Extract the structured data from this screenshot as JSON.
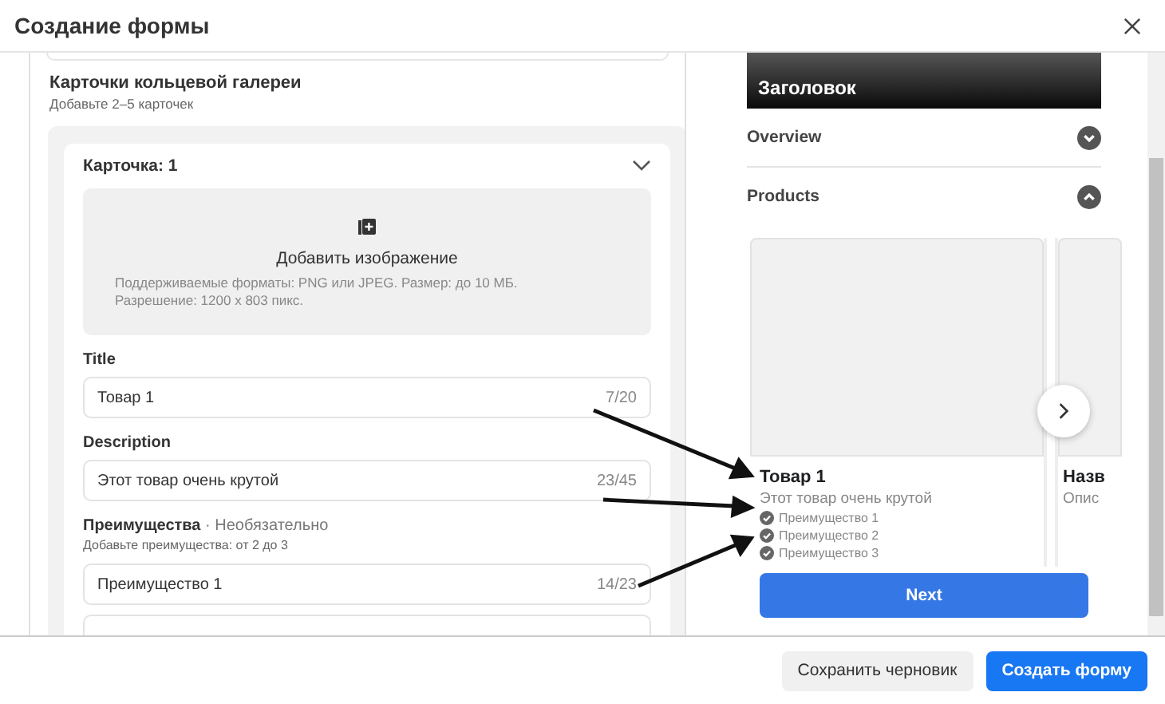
{
  "window": {
    "title": "Создание формы"
  },
  "form": {
    "section_title": "Карточки кольцевой галереи",
    "section_hint": "Добавьте 2–5 карточек",
    "card": {
      "title": "Карточка: 1",
      "expanded": true,
      "upload": {
        "label": "Добавить изображение",
        "hint": "Поддерживаемые форматы: PNG или JPEG. Размер: до 10 МБ. Разрешение: 1200 x 803 пикс."
      },
      "fields": [
        {
          "label": "Title",
          "value": "Товар 1",
          "counter": "7/20"
        },
        {
          "label": "Description",
          "value": "Этот товар очень крутой",
          "counter": "23/45"
        }
      ],
      "benefits": {
        "label": "**Преимущества** · Необязательно",
        "hint": "Добавьте преимущества: от 2 до 3",
        "items": [
          {
            "value": "Преимущество 1",
            "counter": "14/23"
          }
        ]
      }
    }
  },
  "preview": {
    "header_title": "Заголовок",
    "sections": [
      {
        "label": "Overview",
        "expanded": false
      },
      {
        "label": "Products",
        "expanded": true
      }
    ],
    "products": [
      {
        "title": "Товар 1",
        "description": "Этот товар очень крутой",
        "benefits": [
          "Преимущество 1",
          "Преимущество 2",
          "Преимущество 3"
        ]
      },
      {
        "title": "Назв",
        "description": "Опис"
      }
    ],
    "next_button": "Next"
  },
  "footer": {
    "buttons": [
      {
        "label": "Сохранить черновик",
        "kind": "secondary"
      },
      {
        "label": "Создать форму",
        "kind": "primary"
      }
    ]
  }
}
